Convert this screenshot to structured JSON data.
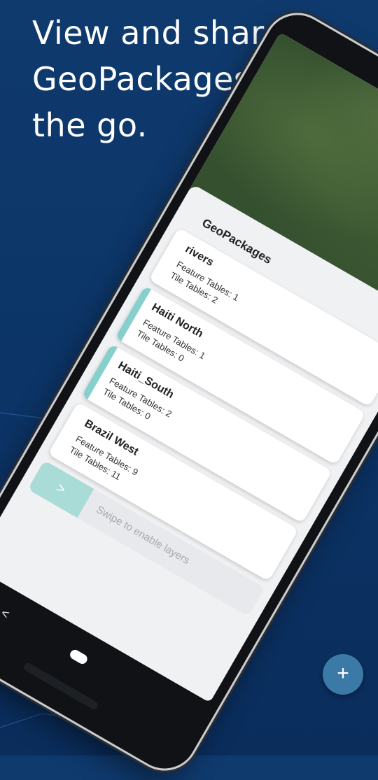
{
  "headline": {
    "line1": "View and share",
    "line2": "GeoPackages on",
    "line3": "the go."
  },
  "sheet": {
    "title": "GeoPackages"
  },
  "geopackages": [
    {
      "name": "rivers",
      "feature_tables": "Feature Tables: 1",
      "tile_tables": "Tile Tables: 2",
      "enabled": false
    },
    {
      "name": "Haiti North",
      "feature_tables": "Feature Tables: 1",
      "tile_tables": "Tile Tables: 0",
      "enabled": true
    },
    {
      "name": "Haiti_South",
      "feature_tables": "Feature Tables: 2",
      "tile_tables": "Tile Tables: 0",
      "enabled": true
    },
    {
      "name": "Brazil West",
      "feature_tables": "Feature Tables: 9",
      "tile_tables": "Tile Tables: 11",
      "enabled": false
    }
  ],
  "swipe": {
    "knob": ">",
    "text": "Swipe to enable layers"
  },
  "nav": {
    "back": "<"
  },
  "fab": {
    "label": "+"
  },
  "colors": {
    "background": "#0c3466",
    "accent_teal": "#86cfcc",
    "fab": "#3b79a6"
  }
}
